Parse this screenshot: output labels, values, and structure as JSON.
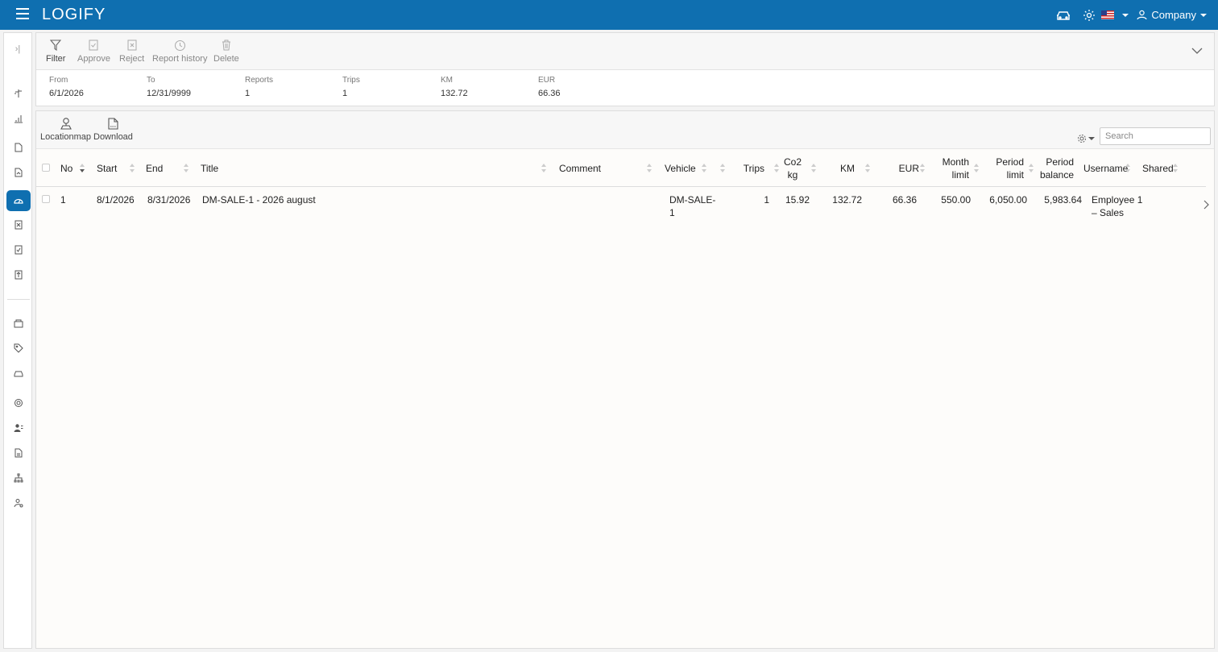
{
  "app": {
    "logo": "LOGIFY"
  },
  "topbar": {
    "company_label": "Company"
  },
  "toolbar": {
    "filter": "Filter",
    "approve": "Approve",
    "reject": "Reject",
    "report_history": "Report history",
    "delete": "Delete"
  },
  "summary": {
    "from_label": "From",
    "from_value": "6/1/2026",
    "to_label": "To",
    "to_value": "12/31/9999",
    "reports_label": "Reports",
    "reports_value": "1",
    "trips_label": "Trips",
    "trips_value": "1",
    "km_label": "KM",
    "km_value": "132.72",
    "eur_label": "EUR",
    "eur_value": "66.36"
  },
  "grid_toolbar": {
    "locationmap": "Locationmap",
    "download": "Download",
    "search_placeholder": "Search"
  },
  "table": {
    "columns": {
      "no": "No",
      "start": "Start",
      "end": "End",
      "title": "Title",
      "comment": "Comment",
      "vehicle": "Vehicle",
      "trips": "Trips",
      "co2_1": "Co2",
      "co2_2": "kg",
      "km": "KM",
      "eur": "EUR",
      "month_limit_1": "Month",
      "month_limit_2": "limit",
      "period_limit_1": "Period",
      "period_limit_2": "limit",
      "period_balance_1": "Period",
      "period_balance_2": "balance",
      "username": "Username",
      "shared": "Shared"
    },
    "rows": [
      {
        "no": "1",
        "start": "8/1/2026",
        "end": "8/31/2026",
        "title": "DM-SALE-1 - 2026 august",
        "comment": "",
        "vehicle_1": "DM-SALE-",
        "vehicle_2": "1",
        "trips": "1",
        "co2": "15.92",
        "km": "132.72",
        "eur": "66.36",
        "month_limit": "550.00",
        "period_limit": "6,050.00",
        "period_balance": "5,983.64",
        "username_1": "Employee 1",
        "username_2": "– Sales",
        "shared": ""
      }
    ]
  },
  "colors": {
    "brand": "#0f6fb0",
    "active_nav": "#0f6fb0"
  }
}
